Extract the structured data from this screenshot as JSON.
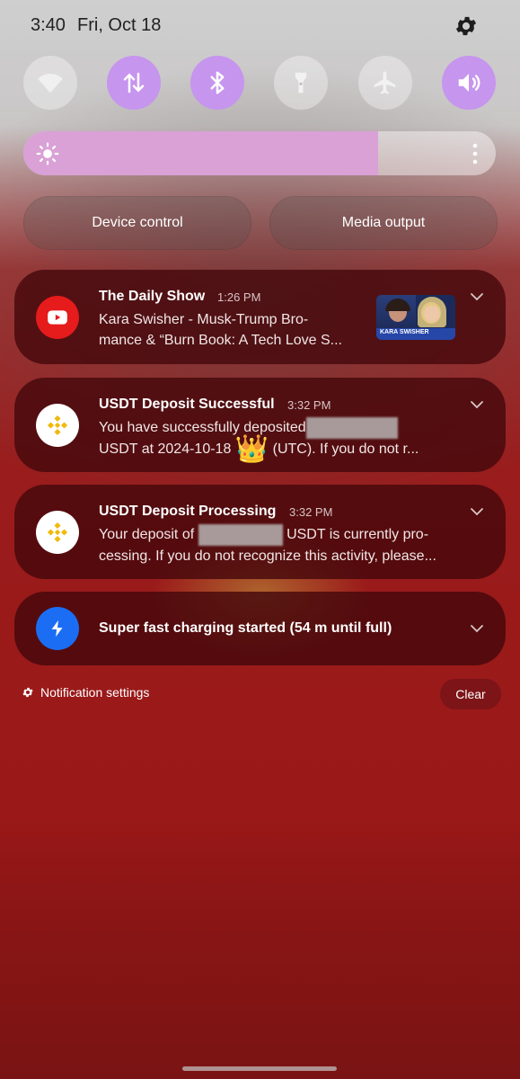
{
  "status_bar": {
    "time": "3:40",
    "date": "Fri, Oct 18",
    "settings_icon": "gear-icon"
  },
  "quick_settings": {
    "tiles": [
      {
        "name": "wifi",
        "icon": "wifi-icon",
        "state": "off"
      },
      {
        "name": "mobile-data",
        "icon": "data-arrows-icon",
        "state": "on"
      },
      {
        "name": "bluetooth",
        "icon": "bluetooth-icon",
        "state": "on"
      },
      {
        "name": "flashlight",
        "icon": "flashlight-icon",
        "state": "off"
      },
      {
        "name": "airplane-mode",
        "icon": "airplane-icon",
        "state": "off"
      },
      {
        "name": "sound",
        "icon": "speaker-icon",
        "state": "on"
      }
    ],
    "brightness_level": 0.75,
    "device_control_label": "Device control",
    "media_output_label": "Media output",
    "active_color": "#c695ee"
  },
  "notifications": [
    {
      "app_icon": "youtube-icon",
      "title": "The Daily Show",
      "time": "1:26 PM",
      "body_line1": "Kara Swisher - Musk-Trump Bro-",
      "body_line2": "mance & “Burn Book: A Tech Love S...",
      "thumbnail_caption": "KARA SWISHER"
    },
    {
      "app_icon": "binance-icon",
      "title": "USDT Deposit Successful",
      "time": "3:32 PM",
      "body_line1": "You have successfully deposited",
      "body_line2_a": "USDT at 2024-10-18",
      "body_line2_b": "(UTC). If you do not r..."
    },
    {
      "app_icon": "binance-icon",
      "title": "USDT Deposit Processing",
      "time": "3:32 PM",
      "body_line1_a": "Your deposit of",
      "body_line1_b": "USDT is currently pro-",
      "body_line2": "cessing. If you do not recognize this activity, please..."
    },
    {
      "app_icon": "lightning-icon",
      "title": "Super fast charging started (54 m until full)"
    }
  ],
  "footer": {
    "notification_settings_label": "Notification settings",
    "clear_label": "Clear"
  },
  "colors": {
    "youtube": "#e61b1b",
    "binance": "#f0b90b",
    "charging": "#1b6ef3"
  }
}
